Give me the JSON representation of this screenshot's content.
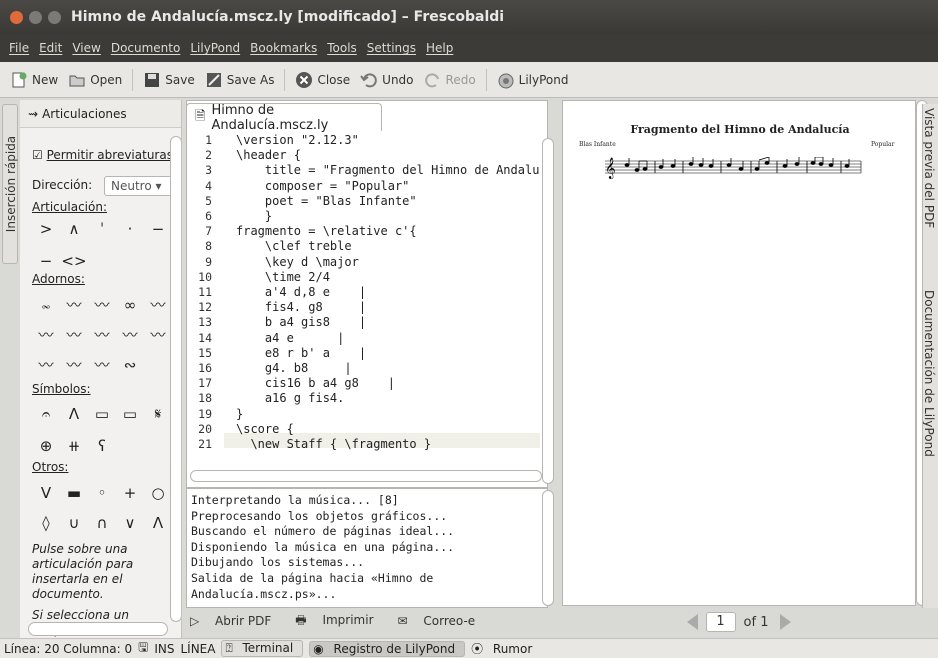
{
  "window": {
    "title": "Himno de Andalucía.mscz.ly [modificado] – Frescobaldi"
  },
  "menu": [
    "File",
    "Edit",
    "View",
    "Documento",
    "LilyPond",
    "Bookmarks",
    "Tools",
    "Settings",
    "Help"
  ],
  "toolbar": {
    "new": "New",
    "open": "Open",
    "save": "Save",
    "save_as": "Save As",
    "close": "Close",
    "undo": "Undo",
    "redo": "Redo",
    "lilypond": "LilyPond"
  },
  "left_tab": "Inserción rápida",
  "panel": {
    "title": "Articulaciones",
    "abbrev": "Permitir abreviaturas",
    "direction_label": "Dirección:",
    "direction_value": "Neutro",
    "articulacion": "Articulación:",
    "adornos": "Adornos:",
    "simbolos": "Símbolos:",
    "otros": "Otros:",
    "hint": "Pulse sobre una articulación para insertarla en el documento.",
    "hint2": "Si selecciona un bloque",
    "art_row1": [
      ">",
      "∧",
      "ˈ",
      "·",
      "−"
    ],
    "art_row2": [
      "−",
      "<>"
    ],
    "orn_row1": [
      "𝆗",
      "〰",
      "〰",
      "∞",
      "〰"
    ],
    "orn_row2": [
      "〰",
      "〰",
      "〰",
      "〰",
      "〰"
    ],
    "orn_row3": [
      "〰",
      "〰",
      "〰",
      "∾"
    ],
    "sym_row1": [
      "𝄐",
      "Λ",
      "▭",
      "▭",
      "𝄋"
    ],
    "sym_row2": [
      "⊕",
      "⧺",
      "ʕ"
    ],
    "otros_row1": [
      "V",
      "▬",
      "◦",
      "+",
      "○"
    ],
    "otros_row2": [
      "◊",
      "∪",
      "∩",
      "∨",
      "Λ"
    ]
  },
  "editor": {
    "tab": "Himno de Andalucía.mscz.ly",
    "lines": [
      {
        "n": "1",
        "t": "\\version \"2.12.3\""
      },
      {
        "n": "2",
        "t": "\\header {"
      },
      {
        "n": "3",
        "t": "    title = \"Fragmento del Himno de Andalucía\""
      },
      {
        "n": "4",
        "t": "    composer = \"Popular\""
      },
      {
        "n": "5",
        "t": "    poet = \"Blas Infante\""
      },
      {
        "n": "6",
        "t": "    }"
      },
      {
        "n": "7",
        "t": "fragmento = \\relative c'{"
      },
      {
        "n": "8",
        "t": "    \\clef treble"
      },
      {
        "n": "9",
        "t": "    \\key d \\major"
      },
      {
        "n": "10",
        "t": "    \\time 2/4"
      },
      {
        "n": "11",
        "t": "    a'4 d,8 e    |"
      },
      {
        "n": "12",
        "t": "    fis4. g8     |"
      },
      {
        "n": "13",
        "t": "    b a4 gis8    |"
      },
      {
        "n": "14",
        "t": "    a4 e      |"
      },
      {
        "n": "15",
        "t": "    e8 r b' a    |"
      },
      {
        "n": "16",
        "t": "    g4. b8     |"
      },
      {
        "n": "17",
        "t": "    cis16 b a4 g8    |"
      },
      {
        "n": "18",
        "t": "    a16 g fis4."
      },
      {
        "n": "19",
        "t": "}"
      },
      {
        "n": "20",
        "t": "\\score {"
      },
      {
        "n": "21",
        "t": "  \\new Staff { \\fragmento }"
      }
    ]
  },
  "log": [
    "Interpretando la música... [8]",
    "Preprocesando los objetos gráficos...",
    "Buscando el número de páginas ideal...",
    "Disponiendo la música en una página...",
    "Dibujando los sistemas...",
    "Salida de la página hacia «Himno de",
    "Andalucía.mscz.ps»..."
  ],
  "logbar": {
    "open_pdf": "Abrir PDF",
    "print": "Imprimir",
    "email": "Correo-e"
  },
  "pdf": {
    "title": "Fragmento del Himno de Andalucía",
    "poet": "Blas Infante",
    "composer": "Popular",
    "page": "1",
    "of": "of 1"
  },
  "right_tabs": [
    "Vista previa del PDF",
    "Documentación de LilyPond"
  ],
  "status": {
    "pos": "Línea: 20 Columna: 0",
    "ins": "INS",
    "linea": "LÍNEA",
    "terminal": "Terminal",
    "registro": "Registro de LilyPond",
    "rumor": "Rumor"
  }
}
